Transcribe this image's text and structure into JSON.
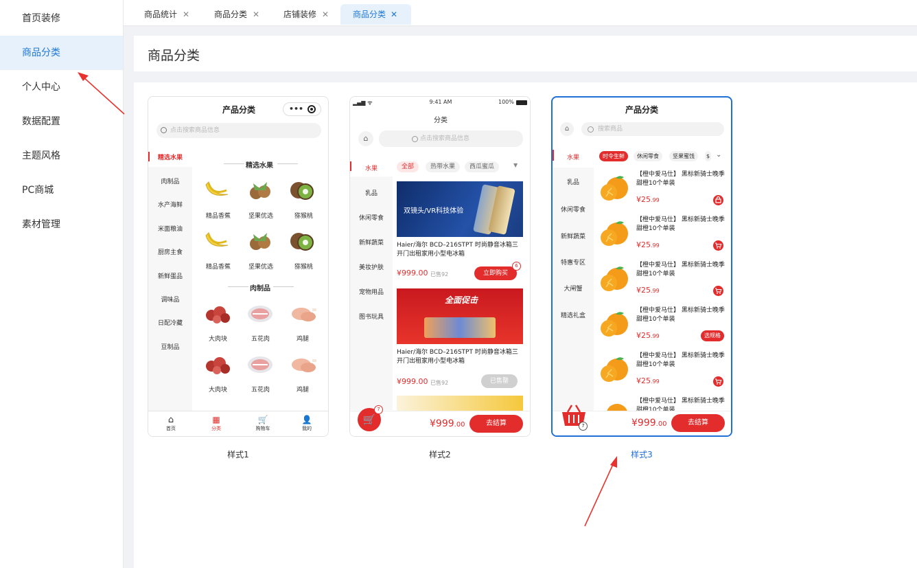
{
  "sidebar": {
    "items": [
      {
        "label": "首页装修"
      },
      {
        "label": "商品分类"
      },
      {
        "label": "个人中心"
      },
      {
        "label": "数据配置"
      },
      {
        "label": "主题风格"
      },
      {
        "label": "PC商城"
      },
      {
        "label": "素材管理"
      }
    ]
  },
  "tabs": [
    {
      "label": "商品统计"
    },
    {
      "label": "商品分类"
    },
    {
      "label": "店铺装修"
    },
    {
      "label": "商品分类"
    }
  ],
  "page_title": "商品分类",
  "styles": [
    {
      "label": "样式1"
    },
    {
      "label": "样式2"
    },
    {
      "label": "样式3"
    }
  ],
  "phone1": {
    "title": "产品分类",
    "search_placeholder": "点击搜索商品信息",
    "categories": [
      "精选水果",
      "肉制品",
      "水产海鲜",
      "米面粮油",
      "厨房主食",
      "新鲜蛋品",
      "调味品",
      "日配冷藏",
      "豆制品"
    ],
    "section1": "精选水果",
    "section2": "肉制品",
    "fruit_row": [
      "精品香蕉",
      "坚果优选",
      "猕猴桃"
    ],
    "meat_row": [
      "大肉块",
      "五花肉",
      "鸡腿"
    ],
    "nav": [
      "首页",
      "分类",
      "购物车",
      "我的"
    ]
  },
  "phone2": {
    "status_time": "9:41 AM",
    "battery": "100%",
    "title": "分类",
    "search_placeholder": "点击搜索商品信息",
    "categories": [
      "水果",
      "乳品",
      "休闲零食",
      "新鲜蔬菜",
      "美妆护肤",
      "宠物用品",
      "图书玩具"
    ],
    "chips": [
      "全部",
      "热带水果",
      "西瓜蜜瓜"
    ],
    "banner1_text": "双镜头/VR科技体验",
    "banner2_text": "全面促击",
    "product_name": "Haier/海尔 BCD–216STPT 时尚静音冰箱三开门出租家用小型电冰箱",
    "price": "¥999.00",
    "sold": "已售92",
    "buy_label": "立即购买",
    "buy_badge": "6",
    "soldout_label": "已售罄",
    "cart_badge": "7",
    "total_price": "¥999",
    "total_decimals": ".00",
    "checkout": "去结算"
  },
  "phone3": {
    "title": "产品分类",
    "search_placeholder": "搜索商品",
    "categories": [
      "水果",
      "乳品",
      "休闲零食",
      "新鲜蔬菜",
      "特惠专区",
      "大闸蟹",
      "精选礼盒"
    ],
    "chips": [
      "时令生鲜",
      "休闲零食",
      "坚果蜜饯",
      "$"
    ],
    "product_name": "【橙中爱马仕】 黑标新骑士晚季甜橙10个单装",
    "price_int": "¥25",
    "price_dec": ".99",
    "spec_label": "选规格",
    "cart_badge": "7",
    "total_price": "¥999",
    "total_decimals": ".00",
    "checkout": "去结算"
  },
  "colors": {
    "accent": "#1e78d7",
    "red": "#e32d2d"
  }
}
